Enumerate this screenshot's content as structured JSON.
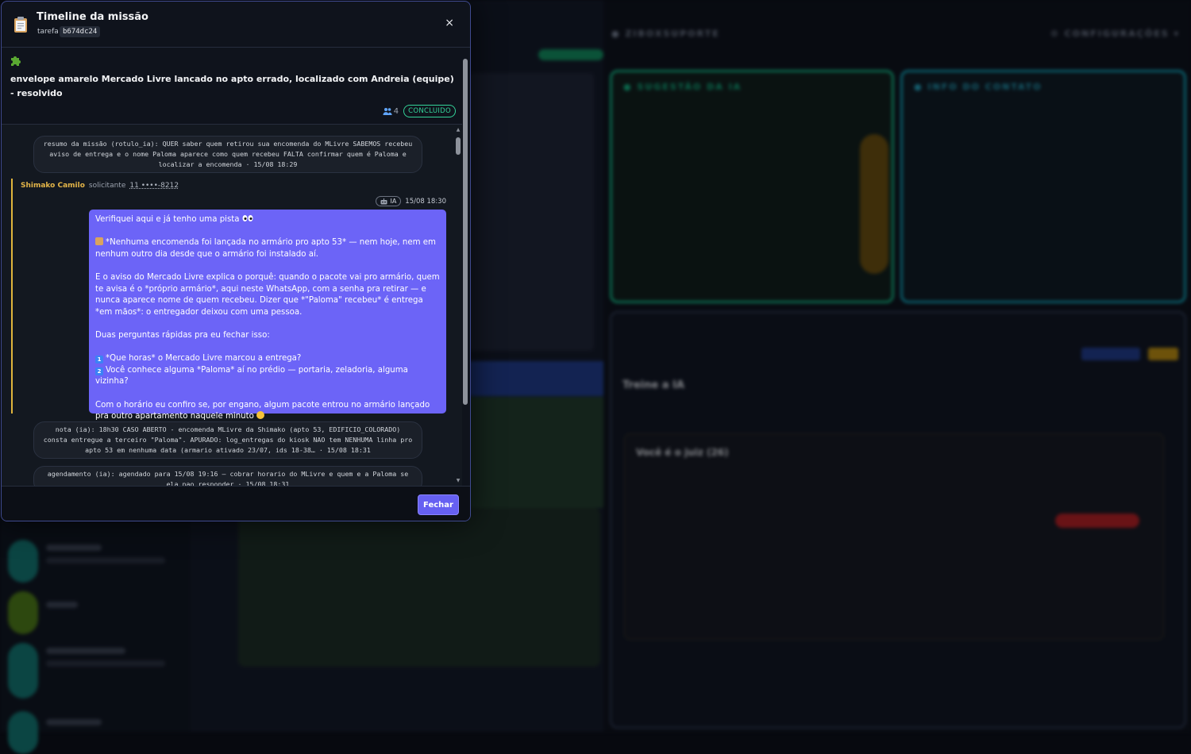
{
  "modal": {
    "title": "Timeline da missão",
    "task_label": "tarefa",
    "task_id": "b674dc24",
    "close_glyph": "×",
    "close_icon": "close-icon",
    "header_icon": "clipboard-icon"
  },
  "mission": {
    "icon": "puzzle-icon",
    "title": "envelope amarelo Mercado Livre lancado no apto errado, localizado com Andreia (equipe) - resolvido",
    "participants": "4",
    "status": "CONCLUIDO"
  },
  "timeline": {
    "summary": "resumo da missão (rotulo_ia): QUER saber quem retirou sua encomenda do MLivre SABEMOS recebeu aviso de entrega e o nome Paloma aparece como quem recebeu FALTA confirmar quem é Paloma e localizar a encomenda · 15/08 18:29",
    "requester": {
      "name": "Shimako Camilo",
      "role": "solicitante",
      "phone": "11 ••••-8212"
    },
    "message": {
      "badge": "IA",
      "time": "15/08 18:30",
      "paragraphs": [
        "Verifiquei aqui e já tenho uma pista",
        "*Nenhuma encomenda foi lançada no armário pro apto 53* — nem hoje, nem em nenhum outro dia desde que o armário foi instalado aí.",
        "E o aviso do Mercado Livre explica o porquê: quando o pacote vai pro armário, quem te avisa é o *próprio armário*, aqui neste WhatsApp, com a senha pra retirar — e nunca aparece nome de quem recebeu. Dizer que *\"Paloma\" recebeu* é entrega *em mãos*: o entregador deixou com uma pessoa.",
        "Duas perguntas rápidas pra eu fechar isso:",
        "Com o horário eu confiro se, por engano, algum pacote entrou no armário lançado pra outro apartamento naquele minuto"
      ],
      "question_1": "*Que horas* o Mercado Livre marcou a entrega?",
      "question_2": "Você conhece alguma *Paloma* aí no prédio — portaria, zeladoria, alguma vizinha?"
    },
    "note": "nota (ia): 18h30 CASO ABERTO - encomenda MLivre da Shimako (apto 53, EDIFICIO_COLORADO) consta entregue a terceiro \"Paloma\". APURADO: log_entregas do kiosk NAO tem NENHUMA linha pro apto 53 em nenhuma data (armario ativado 23/07, ids 18-38… · 15/08 18:31",
    "schedule": "agendamento (ia): agendado para 15/08 19:16 — cobrar horario do MLivre e quem e a Paloma se ela nao responder · 15/08 18:31"
  },
  "footer": {
    "close_label": "Fechar"
  },
  "background": {
    "header_left": "● ZIBOXSUPORTE",
    "header_right": "⚙ CONFIGURAÇÕES ▾",
    "panel_suggestion": "● SUGESTÃO DA IA",
    "panel_contact": "● INFO DO CONTATO",
    "train_title": "Treine a IA",
    "judge_title": "Você é o juiz (26)"
  },
  "colors": {
    "accent": "#6c64f7",
    "status": "#34d399",
    "requester": "#e4b548"
  }
}
